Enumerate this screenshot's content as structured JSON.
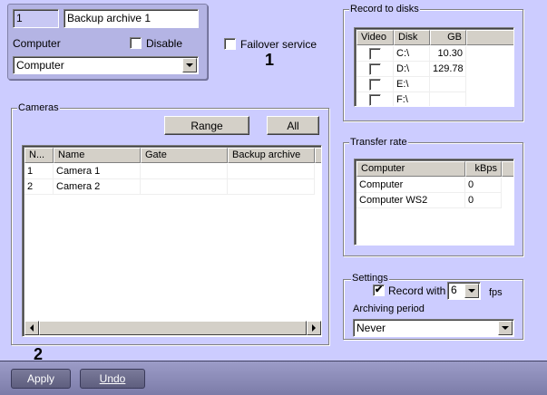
{
  "archive": {
    "id": "1",
    "name": "Backup archive 1",
    "computer_label": "Computer",
    "disable_label": "Disable",
    "disable_checked": false,
    "computer_value": "Computer"
  },
  "failover": {
    "label": "Failover service",
    "checked": false
  },
  "annotations": {
    "one": "1",
    "two": "2"
  },
  "record_disks": {
    "title": "Record to disks",
    "columns": [
      "Video",
      "Disk",
      "GB"
    ],
    "rows": [
      {
        "video": false,
        "disk": "C:\\",
        "gb": "10.30"
      },
      {
        "video": false,
        "disk": "D:\\",
        "gb": "129.78"
      },
      {
        "video": false,
        "disk": "E:\\",
        "gb": ""
      },
      {
        "video": false,
        "disk": "F:\\",
        "gb": ""
      }
    ]
  },
  "cameras": {
    "title": "Cameras",
    "range_label": "Range",
    "all_label": "All",
    "columns": [
      "N...",
      "Name",
      "Gate",
      "Backup archive"
    ],
    "rows": [
      {
        "n": "1",
        "name": "Camera 1",
        "gate": "",
        "backup": ""
      },
      {
        "n": "2",
        "name": "Camera 2",
        "gate": "",
        "backup": ""
      }
    ]
  },
  "transfer": {
    "title": "Transfer rate",
    "columns": [
      "Computer",
      "kBps"
    ],
    "rows": [
      {
        "computer": "Computer",
        "kbps": "0"
      },
      {
        "computer": "Computer WS2",
        "kbps": "0"
      }
    ]
  },
  "settings": {
    "title": "Settings",
    "record_with_label": "Record with",
    "record_checked": true,
    "fps_value": "6",
    "fps_label": "fps",
    "period_label": "Archiving period",
    "period_value": "Never"
  },
  "footer": {
    "apply": "Apply",
    "undo": "Undo"
  }
}
